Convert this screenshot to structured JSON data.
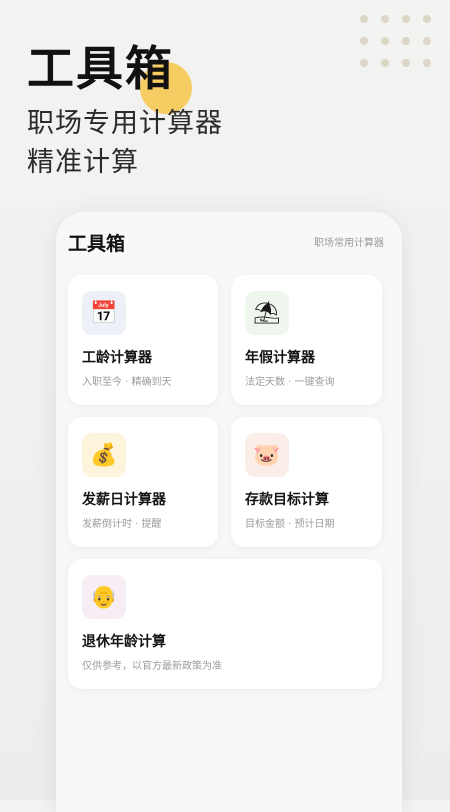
{
  "hero": {
    "title": "工具箱",
    "subtitle_line1": "职场专用计算器",
    "subtitle_line2": "精准计算"
  },
  "panel": {
    "title": "工具箱",
    "subtitle": "职场常用计算器"
  },
  "cards": [
    {
      "title": "工龄计算器",
      "desc": "入职至今 · 精确到天",
      "icon": "calendar-icon",
      "glyph": "📅",
      "icon_bg": "#eef0f8"
    },
    {
      "title": "年假计算器",
      "desc": "法定天数 · 一键查询",
      "icon": "beach-icon",
      "glyph": "⛱",
      "icon_bg": "#eef6ee"
    },
    {
      "title": "发薪日计算器",
      "desc": "发薪倒计时 · 提醒",
      "icon": "money-bag-icon",
      "glyph": "💰",
      "icon_bg": "#fdf4dc"
    },
    {
      "title": "存款目标计算",
      "desc": "目标金额 · 预计日期",
      "icon": "piggy-bank-icon",
      "glyph": "🐷",
      "icon_bg": "#fbeee9"
    },
    {
      "title": "退休年龄计算",
      "desc": "仅供参考，以官方最新政策为准",
      "icon": "older-person-icon",
      "glyph": "👴",
      "icon_bg": "#f6eef4"
    }
  ],
  "colors": {
    "accent_yellow": "#f6cd62",
    "dot": "#dcd6c6"
  }
}
